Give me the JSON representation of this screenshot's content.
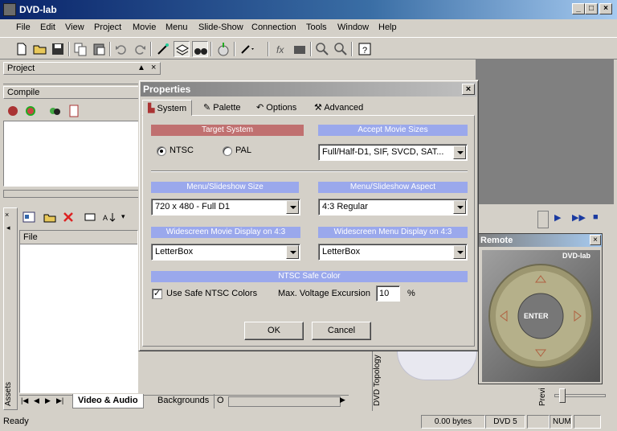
{
  "app": {
    "title": "DVD-lab"
  },
  "menu": [
    "File",
    "Edit",
    "View",
    "Project",
    "Movie",
    "Menu",
    "Slide-Show",
    "Connection",
    "Tools",
    "Window",
    "Help"
  ],
  "panels": {
    "project_label": "Project",
    "compile_label": "Compile",
    "file_col": "File",
    "assets_label": "Assets",
    "dvd_topology_label": "DVD Topology",
    "preview_label": "Previ",
    "bottom_tabs": [
      "Video & Audio",
      "Backgrounds",
      "O"
    ]
  },
  "dialog": {
    "title": "Properties",
    "tabs": [
      "System",
      "Palette",
      "Options",
      "Advanced"
    ],
    "target_system": {
      "header": "Target System",
      "options": [
        "NTSC",
        "PAL"
      ],
      "selected": "NTSC"
    },
    "accept_movie_sizes": {
      "header": "Accept Movie Sizes",
      "value": "Full/Half-D1, SIF, SVCD, SAT..."
    },
    "menu_slideshow_size": {
      "header": "Menu/Slideshow Size",
      "value": "720 x 480 - Full D1"
    },
    "menu_slideshow_aspect": {
      "header": "Menu/Slideshow Aspect",
      "value": "4:3  Regular"
    },
    "widescreen_movie": {
      "header": "Widescreen Movie Display on 4:3",
      "value": "LetterBox"
    },
    "widescreen_menu": {
      "header": "Widescreen Menu Display on 4:3",
      "value": "LetterBox"
    },
    "ntsc_safe": {
      "header": "NTSC Safe Color",
      "checkbox_label": "Use Safe NTSC Colors",
      "checked": true,
      "voltage_label": "Max. Voltage Excursion",
      "voltage_value": "10",
      "unit": "%"
    },
    "ok_label": "OK",
    "cancel_label": "Cancel"
  },
  "remote": {
    "title": "Remote",
    "brand": "DVD-lab",
    "enter_label": "ENTER"
  },
  "statusbar": {
    "ready": "Ready",
    "bytes": "0.00 bytes",
    "disc": "DVD 5",
    "num": "NUM"
  },
  "colors": {
    "red_header": "#c07070",
    "blue_header": "#9aa8ec",
    "title_active": "#0a246a",
    "title_inactive": "#808080"
  }
}
